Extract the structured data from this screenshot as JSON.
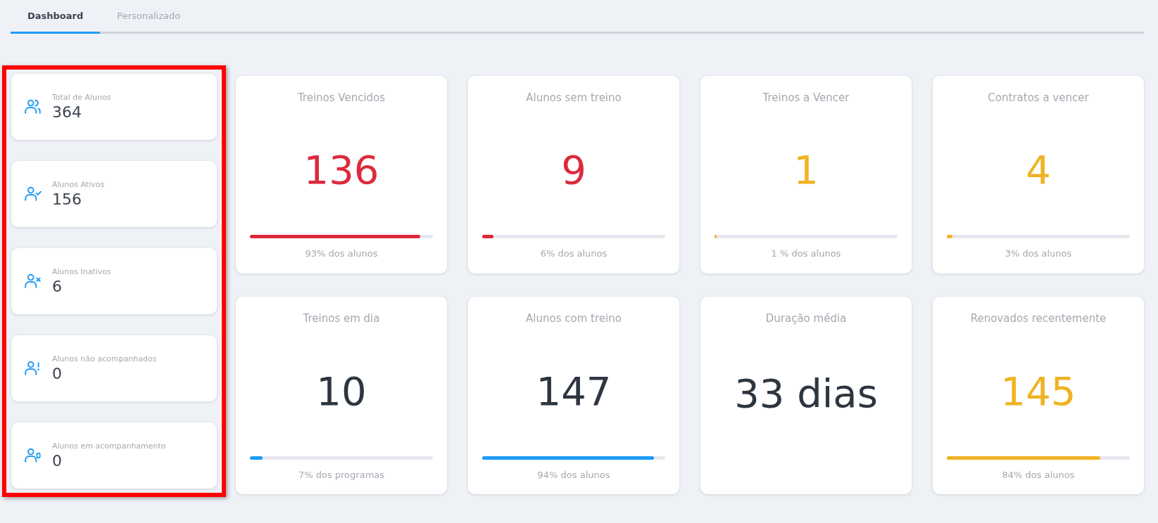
{
  "tabs": [
    {
      "label": "Dashboard",
      "selected": true
    },
    {
      "label": "Personalizado",
      "selected": false
    }
  ],
  "summary": [
    {
      "kind": "group",
      "label": "Total de Alunos",
      "value": "364"
    },
    {
      "kind": "check",
      "label": "Alunos Ativos",
      "value": "156"
    },
    {
      "kind": "cross",
      "label": "Alunos Inativos",
      "value": "6"
    },
    {
      "kind": "alert",
      "label": "Alunos não acompanhados",
      "value": "0"
    },
    {
      "kind": "sync",
      "label": "Alunos em acompanhamento",
      "value": "0"
    }
  ],
  "stats": [
    {
      "title": "Treinos Vencidos",
      "value": "136",
      "kind": "danger",
      "level": 0.93,
      "caption": "93% dos alunos"
    },
    {
      "title": "Alunos sem treino",
      "value": "9",
      "kind": "danger",
      "level": 0.06,
      "caption": "6% dos alunos"
    },
    {
      "title": "Treinos a Vencer",
      "value": "1",
      "kind": "warning",
      "level": 0.01,
      "caption": "1 % dos alunos"
    },
    {
      "title": "Contratos a vencer",
      "value": "4",
      "kind": "warning",
      "level": 0.03,
      "caption": "3% dos alunos"
    },
    {
      "title": "Treinos em dia",
      "value": "10",
      "kind": "neutral",
      "level": 0.07,
      "caption": "7% dos programas"
    },
    {
      "title": "Alunos com treino",
      "value": "147",
      "kind": "neutral",
      "level": 0.94,
      "caption": "94% dos alunos"
    },
    {
      "title": "Duração média",
      "value": "33 dias",
      "kind": "neutral"
    },
    {
      "title": "Renovados recentemente",
      "value": "145",
      "kind": "warning",
      "level": 0.84,
      "caption": "84% dos alunos"
    }
  ]
}
